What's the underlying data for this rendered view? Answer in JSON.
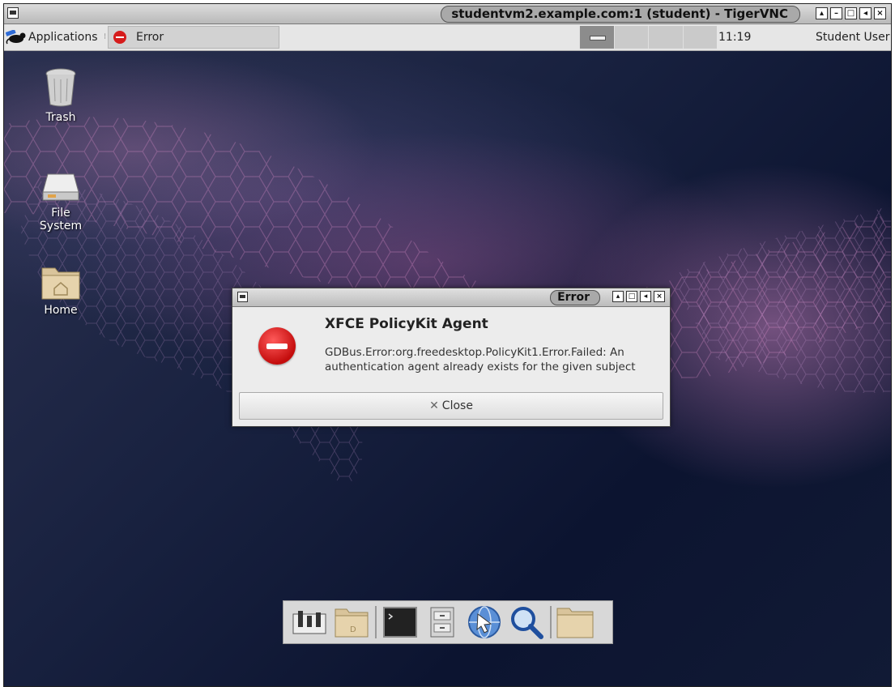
{
  "window": {
    "title": "studentvm2.example.com:1 (student) - TigerVNC",
    "buttons": [
      "▣",
      "‒",
      "□",
      "■",
      "×"
    ]
  },
  "panel": {
    "applications_label": "Applications",
    "task_label": "Error",
    "clock": "11:19",
    "user": "Student User"
  },
  "desktop_icons": {
    "trash": "Trash",
    "filesystem": "File System",
    "home": "Home"
  },
  "dialog": {
    "title": "Error",
    "heading": "XFCE PolicyKit Agent",
    "message": "GDBus.Error:org.freedesktop.PolicyKit1.Error.Failed: An authentication agent already exists for the given subject",
    "close_label": "Close"
  },
  "dock": {
    "items": [
      "settings-manager-icon",
      "desktop-folder-icon",
      "terminal-icon",
      "file-manager-icon",
      "web-browser-icon",
      "search-icon",
      "home-folder-icon"
    ]
  }
}
